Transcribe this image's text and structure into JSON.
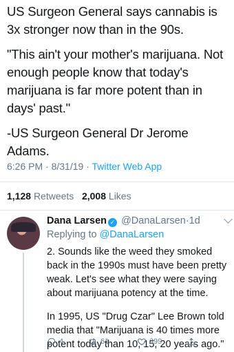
{
  "tweet": {
    "para1": "US Surgeon General says cannabis is 3x stronger now than in the 90s.",
    "para2": "\"This ain't your mother's marijuana. Not enough people know that today's marijuana is far more potent than in days' past.\"",
    "para3": "-US Surgeon General Dr Jerome Adams.",
    "time": "6:26 PM",
    "date": "8/31/19",
    "source": "Twitter Web App",
    "sep": "·",
    "retweets_count": "1,128",
    "retweets_label": "Retweets",
    "likes_count": "2,008",
    "likes_label": "Likes"
  },
  "reply": {
    "name": "Dana Larsen",
    "handle": "@DanaLarsen",
    "age": "1d",
    "replying_prefix": "Replying to",
    "replying_to": "@DanaLarsen",
    "text1": "2. Sounds like the weed they smoked back in the 1990s must have been pretty weak. Let's see what they were saying about marijuana potency at the time.",
    "text2": "In 1995, US \"Drug Czar\" Lee Brown told media that \"Marijuana is 40 times more potent today than 10, 15, 20 years ago.\"",
    "reply_count": "4",
    "retweet_count": "61",
    "like_count": "399"
  },
  "icons": [
    "verified-badge-icon",
    "chevron-down-icon",
    "reply-icon",
    "retweet-icon",
    "like-icon",
    "share-icon"
  ],
  "colors": {
    "link": "#1da1f2",
    "muted": "#657786",
    "text": "#14171a"
  }
}
